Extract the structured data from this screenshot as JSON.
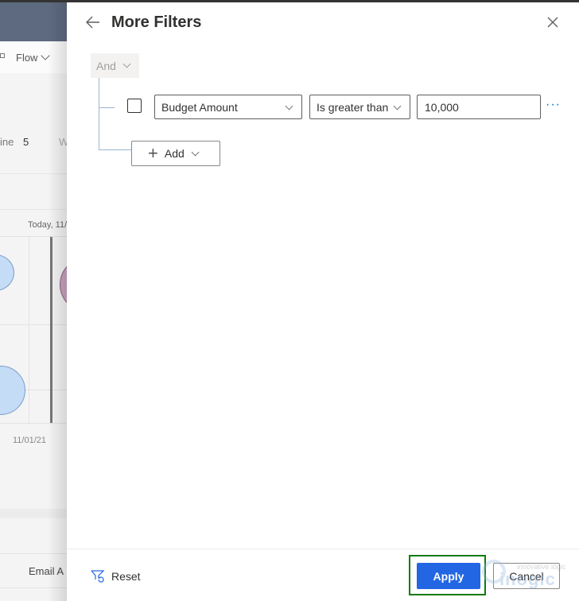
{
  "background": {
    "command_bar": {
      "flow_label": "Flow"
    },
    "summary": {
      "label_fragment": "ine",
      "count": "5",
      "next_fragment": "W"
    },
    "timeline": {
      "today_label": "Today, 11/",
      "date_label": "11/01/21"
    },
    "table": {
      "column_fragment": "Email A"
    }
  },
  "panel": {
    "title": "More Filters",
    "group_operator": "And",
    "condition": {
      "checked": false,
      "field": "Budget Amount",
      "operator": "Is greater than",
      "value": "10,000"
    },
    "add_label": "Add",
    "footer": {
      "reset_label": "Reset",
      "apply_label": "Apply",
      "cancel_label": "Cancel"
    },
    "watermark": {
      "tagline": "innovative logic",
      "logo": "inogic"
    }
  },
  "colors": {
    "accent": "#2266e3",
    "highlight_outline": "#107c10",
    "tree_line": "#9ab5d2",
    "link": "#0078d4"
  },
  "icons": {
    "back": "arrow-left-icon",
    "close": "close-icon",
    "more": "ellipsis-icon",
    "add": "plus-icon",
    "reset": "filter-reset-icon"
  }
}
